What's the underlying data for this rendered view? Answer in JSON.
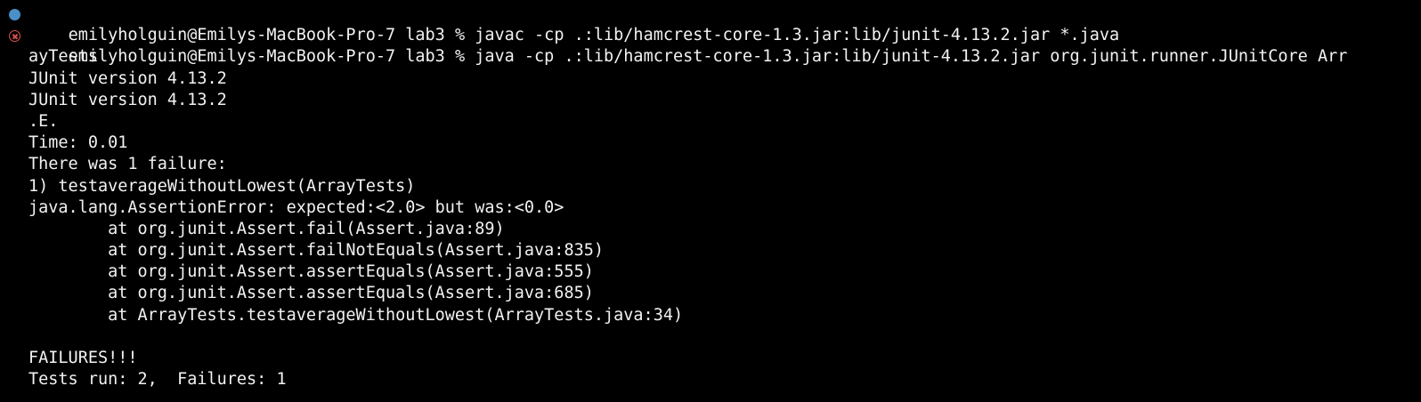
{
  "colors": {
    "background": "#000000",
    "foreground": "#f2f2f2",
    "success_marker": "#4a8fc7",
    "error_marker": "#d9534f"
  },
  "lines": [
    {
      "text": "emilyholguin@Emilys-MacBook-Pro-7 lab3 % javac -cp .:lib/hamcrest-core-1.3.jar:lib/junit-4.13.2.jar *.java",
      "marker": "success-dot-icon"
    },
    {
      "text": "emilyholguin@Emilys-MacBook-Pro-7 lab3 % java -cp .:lib/hamcrest-core-1.3.jar:lib/junit-4.13.2.jar org.junit.runner.JUnitCore Arr",
      "marker": "error-circle-x-icon"
    },
    {
      "text": "ayTests"
    },
    {
      "text": "JUnit version 4.13.2"
    },
    {
      "text": "JUnit version 4.13.2"
    },
    {
      "text": ".E."
    },
    {
      "text": "Time: 0.01"
    },
    {
      "text": "There was 1 failure:"
    },
    {
      "text": "1) testaverageWithoutLowest(ArrayTests)"
    },
    {
      "text": "java.lang.AssertionError: expected:<2.0> but was:<0.0>"
    },
    {
      "text": "        at org.junit.Assert.fail(Assert.java:89)"
    },
    {
      "text": "        at org.junit.Assert.failNotEquals(Assert.java:835)"
    },
    {
      "text": "        at org.junit.Assert.assertEquals(Assert.java:555)"
    },
    {
      "text": "        at org.junit.Assert.assertEquals(Assert.java:685)"
    },
    {
      "text": "        at ArrayTests.testaverageWithoutLowest(ArrayTests.java:34)"
    },
    {
      "text": ""
    },
    {
      "text": "FAILURES!!!"
    },
    {
      "text": "Tests run: 2,  Failures: 1"
    }
  ]
}
